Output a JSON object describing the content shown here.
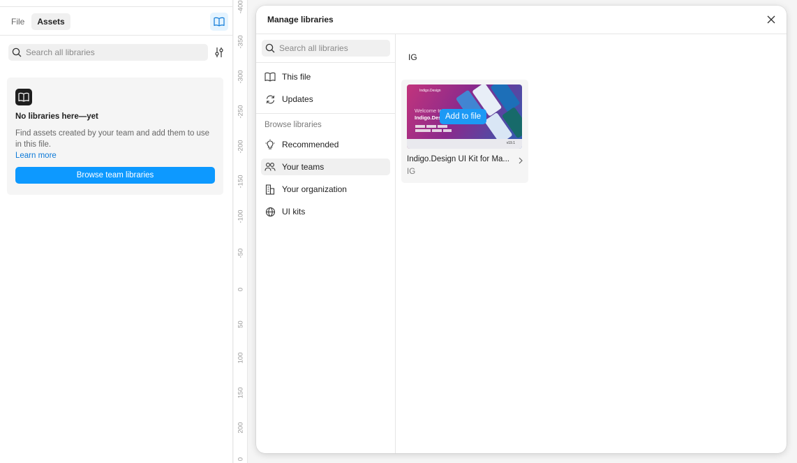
{
  "left_panel": {
    "tabs": [
      {
        "label": "File",
        "active": false
      },
      {
        "label": "Assets",
        "active": true
      }
    ],
    "library_button_icon": "book-open-icon",
    "search": {
      "placeholder": "Search all libraries",
      "value": ""
    },
    "filter_icon": "sliders-icon",
    "empty_state": {
      "icon": "book-open-icon",
      "title": "No libraries here—yet",
      "description": "Find assets created by your team and add them to use in this file.",
      "learn_more": "Learn more",
      "button": "Browse team libraries"
    }
  },
  "ruler": {
    "labels": [
      "-400",
      "-350",
      "-300",
      "-250",
      "-200",
      "-150",
      "-100",
      "-50",
      "0",
      "50",
      "100",
      "150",
      "200",
      "0"
    ]
  },
  "modal": {
    "title": "Manage libraries",
    "close_icon": "close-icon",
    "search": {
      "placeholder": "Search all libraries",
      "value": ""
    },
    "nav_top": [
      {
        "label": "This file",
        "icon": "book-open-icon"
      },
      {
        "label": "Updates",
        "icon": "refresh-icon"
      }
    ],
    "section_label": "Browse libraries",
    "nav_browse": [
      {
        "label": "Recommended",
        "icon": "lightbulb-icon",
        "active": false
      },
      {
        "label": "Your teams",
        "icon": "people-icon",
        "active": true
      },
      {
        "label": "Your organization",
        "icon": "building-icon",
        "active": false
      },
      {
        "label": "UI kits",
        "icon": "globe-icon",
        "active": false
      }
    ],
    "team_heading": "IG",
    "libraries": [
      {
        "name": "Indigo.Design UI Kit for Ma...",
        "team": "IG",
        "action": "Add to file",
        "thumb_brand": "Indigo.Design",
        "thumb_welcome": "Welcome to",
        "thumb_title": "Indigo.Design",
        "thumb_version": "v19.1"
      }
    ]
  },
  "colors": {
    "accent": "#0d99ff",
    "link": "#0d7ad8",
    "thumb_magenta": "#c2347c",
    "thumb_blue": "#2b5fb5"
  }
}
